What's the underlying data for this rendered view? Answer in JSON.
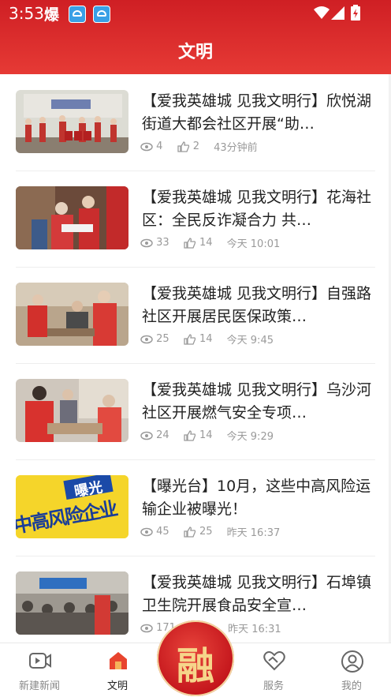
{
  "status_bar": {
    "time": "3:53",
    "boom_glyph": "爆"
  },
  "header": {
    "title": "文明"
  },
  "articles": [
    {
      "title": "【爱我英雄城 见我文明行】欣悦湖街道大都会社区开展“助…",
      "views": "4",
      "likes": "2",
      "time": "43分钟前"
    },
    {
      "title": "【爱我英雄城 见我文明行】花海社区：全民反诈凝合力 共…",
      "views": "33",
      "likes": "14",
      "time": "今天 10:01"
    },
    {
      "title": "【爱我英雄城 见我文明行】自强路社区开展居民医保政策…",
      "views": "25",
      "likes": "14",
      "time": "今天 9:45"
    },
    {
      "title": "【爱我英雄城 见我文明行】乌沙河社区开展燃气安全专项…",
      "views": "24",
      "likes": "14",
      "time": "今天 9:29"
    },
    {
      "title": "【曝光台】10月，这些中高风险运输企业被曝光！",
      "views": "45",
      "likes": "25",
      "time": "昨天 16:37",
      "thumb_text_top": "曝光",
      "thumb_text_main": "中高风险企业"
    },
    {
      "title": "【爱我英雄城 见我文明行】石埠镇卫生院开展食品安全宣…",
      "views": "171",
      "likes": "",
      "time": "昨天 16:31"
    }
  ],
  "tabbar": {
    "items": [
      {
        "label": "新建新闻",
        "icon": "video-icon"
      },
      {
        "label": "文明",
        "icon": "home-icon"
      },
      {
        "label": "服务",
        "icon": "handshake-heart-icon"
      },
      {
        "label": "我的",
        "icon": "user-icon"
      }
    ],
    "center_glyph": "融"
  },
  "colors": {
    "brand_red": "#d8262a",
    "text": "#222222",
    "meta": "#9a9a9a"
  }
}
